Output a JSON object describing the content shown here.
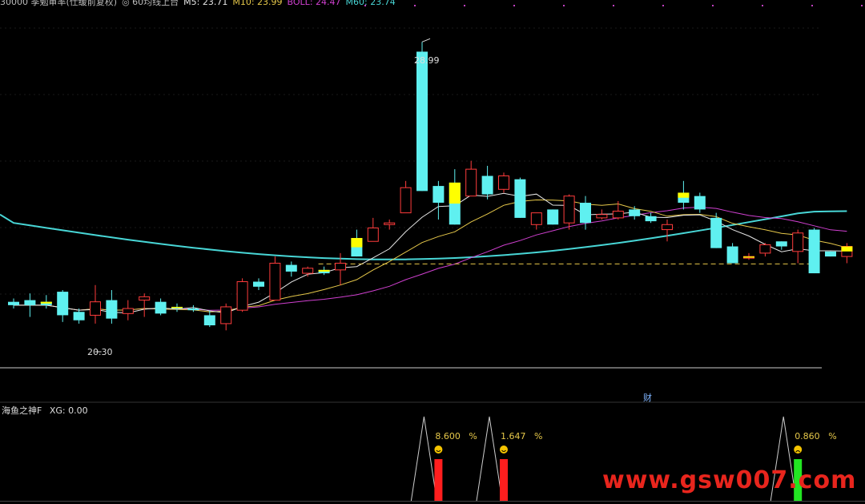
{
  "header": {
    "parts": [
      {
        "text": "30000 季勉审率(仕缓前复权)",
        "color": "#bbbbbb"
      },
      {
        "text": "◎ 60均线上台",
        "color": "#bbbbbb"
      },
      {
        "text": "M5: 23.71",
        "color": "#e6e6e6"
      },
      {
        "text": "M10: 23.99",
        "color": "#e6c84a"
      },
      {
        "text": "BOLL: 24.47",
        "color": "#d040d0"
      },
      {
        "text": "M60: 23.74",
        "color": "#48d6d6"
      }
    ]
  },
  "indicator": {
    "name": "海鱼之神F",
    "xg_label": "XG: 0.00",
    "signals": [
      {
        "index": 26,
        "value_label": "8.600",
        "unit": "%",
        "color": "#ff1e1e",
        "height": 52,
        "face": "smile"
      },
      {
        "index": 30,
        "value_label": "1.647",
        "unit": "%",
        "color": "#ff1e1e",
        "height": 52,
        "face": "smile"
      },
      {
        "index": 48,
        "value_label": "0.860",
        "unit": "%",
        "color": "#22e622",
        "height": 52,
        "face": "frown"
      }
    ]
  },
  "chart_data": {
    "type": "candlestick",
    "high_label": "28.99",
    "low_label": "20.30",
    "fin_marker": "财",
    "ylim": [
      19.5,
      30.0
    ],
    "colors": {
      "up": "#ff3c3c",
      "down": "#5ff0f0",
      "yellow": "#ffff00",
      "ma5": "#e6e6e6",
      "ma10": "#e6c84a",
      "boll": "#d040d0",
      "ma60": "#48d6d6",
      "support": "#e6c84a"
    },
    "support_level": 22.38,
    "candles": [
      {
        "o": 21.25,
        "h": 21.35,
        "l": 21.05,
        "c": 21.15
      },
      {
        "o": 21.3,
        "h": 21.5,
        "l": 20.8,
        "c": 21.15
      },
      {
        "o": 21.25,
        "h": 21.45,
        "l": 21.05,
        "c": 21.15,
        "y": 1
      },
      {
        "o": 21.55,
        "h": 21.6,
        "l": 20.65,
        "c": 20.85
      },
      {
        "o": 20.95,
        "h": 21.05,
        "l": 20.6,
        "c": 20.7
      },
      {
        "o": 20.85,
        "h": 21.75,
        "l": 20.6,
        "c": 21.25
      },
      {
        "o": 21.3,
        "h": 21.6,
        "l": 20.6,
        "c": 20.75
      },
      {
        "o": 20.9,
        "h": 21.3,
        "l": 20.7,
        "c": 21.05
      },
      {
        "o": 21.3,
        "h": 21.5,
        "l": 20.8,
        "c": 21.4
      },
      {
        "o": 21.25,
        "h": 21.35,
        "l": 20.85,
        "c": 20.9
      },
      {
        "o": 21.1,
        "h": 21.2,
        "l": 20.95,
        "c": 21.05,
        "y": 1
      },
      {
        "o": 21.05,
        "h": 21.15,
        "l": 20.95,
        "c": 21.0
      },
      {
        "o": 20.85,
        "h": 21.0,
        "l": 20.5,
        "c": 20.55
      },
      {
        "o": 20.6,
        "h": 21.2,
        "l": 20.4,
        "c": 21.1
      },
      {
        "o": 21.0,
        "h": 21.95,
        "l": 20.95,
        "c": 21.85
      },
      {
        "o": 21.85,
        "h": 21.95,
        "l": 21.6,
        "c": 21.7
      },
      {
        "o": 21.3,
        "h": 22.6,
        "l": 21.3,
        "c": 22.4
      },
      {
        "o": 22.35,
        "h": 22.45,
        "l": 22.0,
        "c": 22.15
      },
      {
        "o": 22.1,
        "h": 22.3,
        "l": 22.0,
        "c": 22.25
      },
      {
        "o": 22.2,
        "h": 22.3,
        "l": 22.05,
        "c": 22.1,
        "y": 1
      },
      {
        "o": 22.2,
        "h": 22.7,
        "l": 21.75,
        "c": 22.4
      },
      {
        "o": 23.15,
        "h": 23.4,
        "l": 22.6,
        "c": 22.6,
        "y": 1
      },
      {
        "o": 23.05,
        "h": 23.75,
        "l": 23.05,
        "c": 23.45
      },
      {
        "o": 23.55,
        "h": 23.7,
        "l": 23.4,
        "c": 23.6
      },
      {
        "o": 23.9,
        "h": 24.85,
        "l": 23.9,
        "c": 24.65
      },
      {
        "o": 28.7,
        "h": 28.99,
        "l": 24.55,
        "c": 24.55
      },
      {
        "o": 24.7,
        "h": 24.85,
        "l": 23.7,
        "c": 24.2
      },
      {
        "o": 24.8,
        "h": 25.2,
        "l": 23.55,
        "c": 23.55,
        "y": 1
      },
      {
        "o": 24.4,
        "h": 25.45,
        "l": 24.4,
        "c": 25.2
      },
      {
        "o": 25.0,
        "h": 25.3,
        "l": 24.3,
        "c": 24.45
      },
      {
        "o": 24.6,
        "h": 25.1,
        "l": 24.5,
        "c": 25.0
      },
      {
        "o": 24.9,
        "h": 24.95,
        "l": 23.75,
        "c": 23.75
      },
      {
        "o": 23.55,
        "h": 23.9,
        "l": 23.4,
        "c": 23.9
      },
      {
        "o": 24.0,
        "h": 24.0,
        "l": 23.55,
        "c": 23.55
      },
      {
        "o": 23.6,
        "h": 24.45,
        "l": 23.4,
        "c": 24.4
      },
      {
        "o": 24.2,
        "h": 24.4,
        "l": 23.4,
        "c": 23.6
      },
      {
        "o": 23.75,
        "h": 24.0,
        "l": 23.7,
        "c": 23.85
      },
      {
        "o": 23.75,
        "h": 24.25,
        "l": 23.7,
        "c": 23.95
      },
      {
        "o": 24.0,
        "h": 24.1,
        "l": 23.7,
        "c": 23.8
      },
      {
        "o": 23.8,
        "h": 23.9,
        "l": 23.6,
        "c": 23.65
      },
      {
        "o": 23.4,
        "h": 23.7,
        "l": 23.05,
        "c": 23.55
      },
      {
        "o": 24.5,
        "h": 24.85,
        "l": 24.0,
        "c": 24.2,
        "y": 1
      },
      {
        "o": 24.4,
        "h": 24.5,
        "l": 23.9,
        "c": 24.0
      },
      {
        "o": 23.75,
        "h": 23.9,
        "l": 22.85,
        "c": 22.85
      },
      {
        "o": 22.9,
        "h": 23.0,
        "l": 22.4,
        "c": 22.4
      },
      {
        "o": 22.55,
        "h": 22.7,
        "l": 22.5,
        "c": 22.6,
        "y": 1
      },
      {
        "o": 22.7,
        "h": 23.0,
        "l": 22.6,
        "c": 22.95
      },
      {
        "o": 23.05,
        "h": 23.05,
        "l": 22.8,
        "c": 22.9
      },
      {
        "o": 22.75,
        "h": 23.4,
        "l": 22.4,
        "c": 23.3
      },
      {
        "o": 23.4,
        "h": 23.45,
        "l": 22.1,
        "c": 22.1
      },
      {
        "o": 22.75,
        "h": 22.75,
        "l": 22.6,
        "c": 22.6
      },
      {
        "o": 22.6,
        "h": 23.0,
        "l": 22.4,
        "c": 22.9,
        "y": 1
      }
    ]
  }
}
